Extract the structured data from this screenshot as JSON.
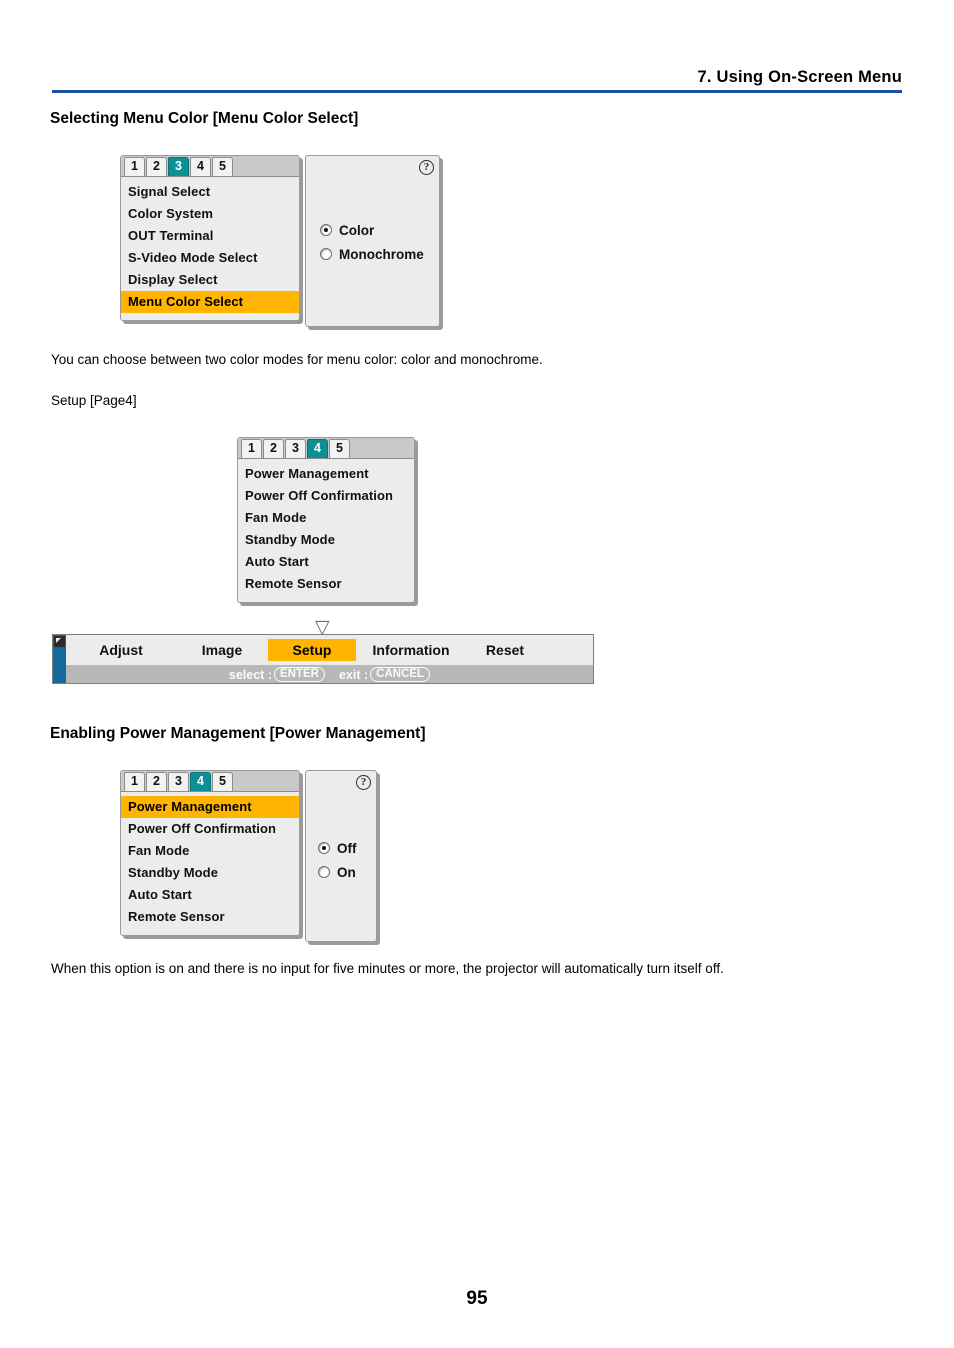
{
  "header": {
    "chapter_title": "7. Using On-Screen Menu",
    "rule_color": "#1b519e"
  },
  "page_number": "95",
  "sections": [
    {
      "heading": "Selecting Menu Color [Menu Color Select]",
      "body": "You can choose between two color modes for menu color: color and monochrome."
    },
    {
      "heading": "Enabling Power Management [Power Management]",
      "body": "When this option is on and there is no input for five minutes or more, the projector will automatically turn itself off."
    }
  ],
  "captions": {
    "setup_page": "Setup [Page4]"
  },
  "colors": {
    "tab_active": "#0d9094",
    "row_selected": "#ffb400",
    "rail": "#14699b",
    "panel_bg": "#ececed"
  },
  "osd_menu_color": {
    "tabs": [
      "1",
      "2",
      "3",
      "4",
      "5"
    ],
    "active_tab": "3",
    "items": [
      "Signal Select",
      "Color System",
      "OUT Terminal",
      "S-Video Mode Select",
      "Display Select",
      "Menu Color Select"
    ],
    "selected_item": "Menu Color Select",
    "help_icon": "question-mark-icon",
    "options": [
      {
        "label": "Color",
        "selected": true
      },
      {
        "label": "Monochrome",
        "selected": false
      }
    ]
  },
  "osd_setup_page4": {
    "tabs": [
      "1",
      "2",
      "3",
      "4",
      "5"
    ],
    "active_tab": "4",
    "items": [
      "Power Management",
      "Power Off Confirmation",
      "Fan Mode",
      "Standby Mode",
      "Auto Start",
      "Remote Sensor"
    ],
    "selected_item": ""
  },
  "osd_power_management": {
    "tabs": [
      "1",
      "2",
      "3",
      "4",
      "5"
    ],
    "active_tab": "4",
    "items": [
      "Power Management",
      "Power Off Confirmation",
      "Fan Mode",
      "Standby Mode",
      "Auto Start",
      "Remote Sensor"
    ],
    "selected_item": "Power Management",
    "help_icon": "question-mark-icon",
    "options": [
      {
        "label": "Off",
        "selected": true
      },
      {
        "label": "On",
        "selected": false
      }
    ]
  },
  "menubar": {
    "items": [
      {
        "label": "Adjust",
        "active": false
      },
      {
        "label": "Image",
        "active": false
      },
      {
        "label": "Setup",
        "active": true
      },
      {
        "label": "Information",
        "active": false
      },
      {
        "label": "Reset",
        "active": false
      }
    ],
    "hints": [
      {
        "prefix": "select :",
        "key": "ENTER"
      },
      {
        "prefix": "exit :",
        "key": "CANCEL"
      }
    ]
  }
}
